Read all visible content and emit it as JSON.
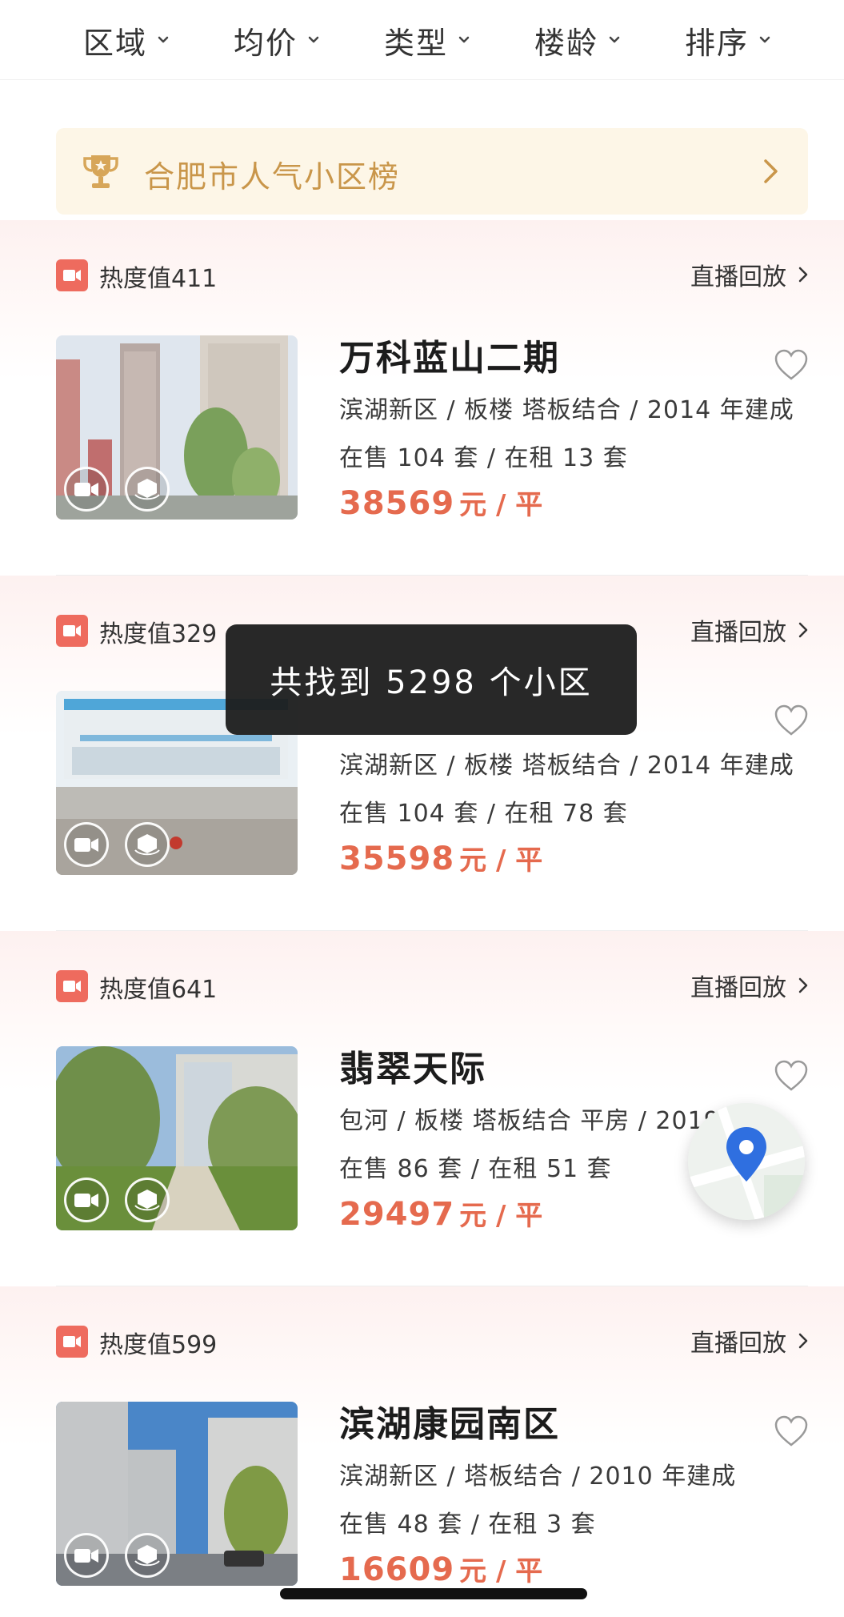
{
  "filters": [
    {
      "label": "区域"
    },
    {
      "label": "均价"
    },
    {
      "label": "类型"
    },
    {
      "label": "楼龄"
    },
    {
      "label": "排序"
    }
  ],
  "banner": {
    "title": "合肥市人气小区榜",
    "icon": "trophy-icon"
  },
  "listings": [
    {
      "heat": "热度值411",
      "replay": "直播回放",
      "name": "万科蓝山二期",
      "info": "滨湖新区 / 板楼  塔板结合 / 2014 年建成",
      "stock": "在售 104 套 / 在租 13 套",
      "price": "38569",
      "unit": "元 / 平"
    },
    {
      "heat": "热度值329",
      "replay": "直播回放",
      "name": "",
      "info": "滨湖新区 / 板楼  塔板结合 / 2014 年建成",
      "stock": "在售 104 套 / 在租 78 套",
      "price": "35598",
      "unit": "元 / 平"
    },
    {
      "heat": "热度值641",
      "replay": "直播回放",
      "name": "翡翠天际",
      "info": "包河 / 板楼  塔板结合  平房 / 2019 年",
      "stock": "在售 86 套 / 在租 51 套",
      "price": "29497",
      "unit": "元 / 平"
    },
    {
      "heat": "热度值599",
      "replay": "直播回放",
      "name": "滨湖康园南区",
      "info": "滨湖新区 / 塔板结合 / 2010 年建成",
      "stock": "在售 48 套 / 在租 3 套",
      "price": "16609",
      "unit": "元 / 平"
    }
  ],
  "toast": {
    "text": "共找到 5298 个小区"
  },
  "colors": {
    "price": "#e56a4e",
    "banner_bg": "#fdf6e7",
    "banner_text": "#c9964a",
    "hot_badge": "#ee6b5e"
  }
}
